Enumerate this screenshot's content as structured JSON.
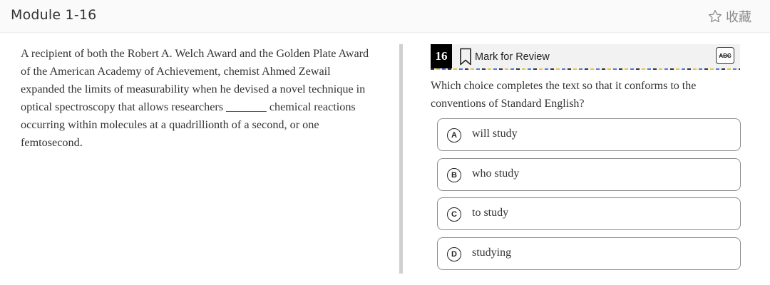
{
  "header": {
    "module_title": "Module 1-16",
    "favorite_label": "收藏"
  },
  "passage": {
    "text": "A recipient of both the Robert A. Welch Award and the Golden Plate Award of the American Academy of Achievement, chemist Ahmed Zewail expanded the limits of measurability when he devised a novel technique in optical spectroscopy that allows researchers _______ chemical reactions occurring within molecules at a quadrillionth of a second, or one femtosecond."
  },
  "question": {
    "number": "16",
    "mark_for_review_label": "Mark for Review",
    "abc_label": "ABC",
    "prompt": "Which choice completes the text so that it conforms to the conventions of Standard English?",
    "choices": [
      {
        "letter": "A",
        "text": "will study"
      },
      {
        "letter": "B",
        "text": "who study"
      },
      {
        "letter": "C",
        "text": "to study"
      },
      {
        "letter": "D",
        "text": "studying"
      }
    ]
  }
}
